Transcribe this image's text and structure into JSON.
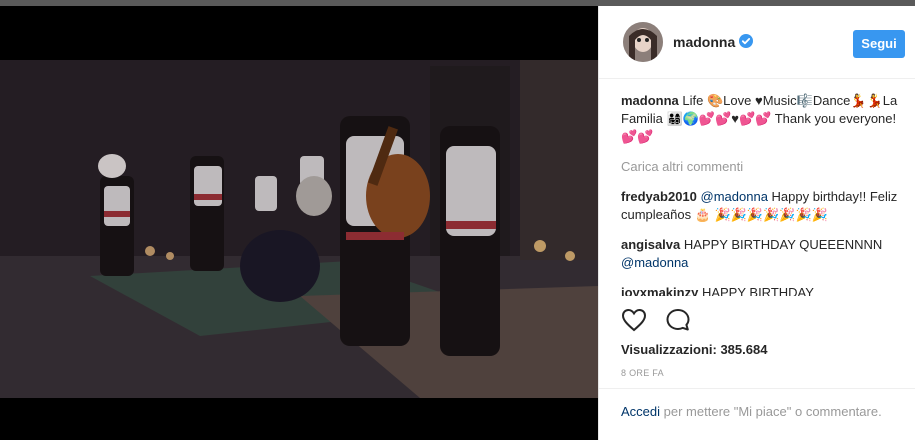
{
  "post": {
    "username": "madonna",
    "follow_label": "Segui",
    "caption": {
      "author": "madonna",
      "text": "Life 🎨Love ♥Music🎼Dance💃💃La Familia 👨‍👩‍👧‍👦🌍💕💕♥💕💕 Thank you everyone! 💕💕"
    },
    "load_more_label": "Carica altri commenti",
    "comments": [
      {
        "author": "fredyab2010",
        "mention": "@madonna",
        "text": "Happy birthday!! Feliz cumpleaños 🎂 🎉🎉🎉🎉🎉🎉🎉"
      },
      {
        "author": "angisalva",
        "text": "HAPPY BIRTHDAY QUEEENNNN",
        "mention": "@madonna"
      },
      {
        "author": "joyxmakinzy",
        "text": "HAPPY BIRTHDAY"
      }
    ],
    "views_label": "Visualizzazioni: 385.684",
    "time_label": "8 ORE FA",
    "login": {
      "link": "Accedi",
      "text": "per mettere \"Mi piace\" o commentare."
    }
  },
  "icons": {
    "like": "heart-icon",
    "comment": "comment-icon",
    "verified": "verified-badge-icon"
  },
  "colors": {
    "follow_button": "#3897f0",
    "link": "#003569",
    "muted": "#999999",
    "video_bg": "#000000"
  }
}
